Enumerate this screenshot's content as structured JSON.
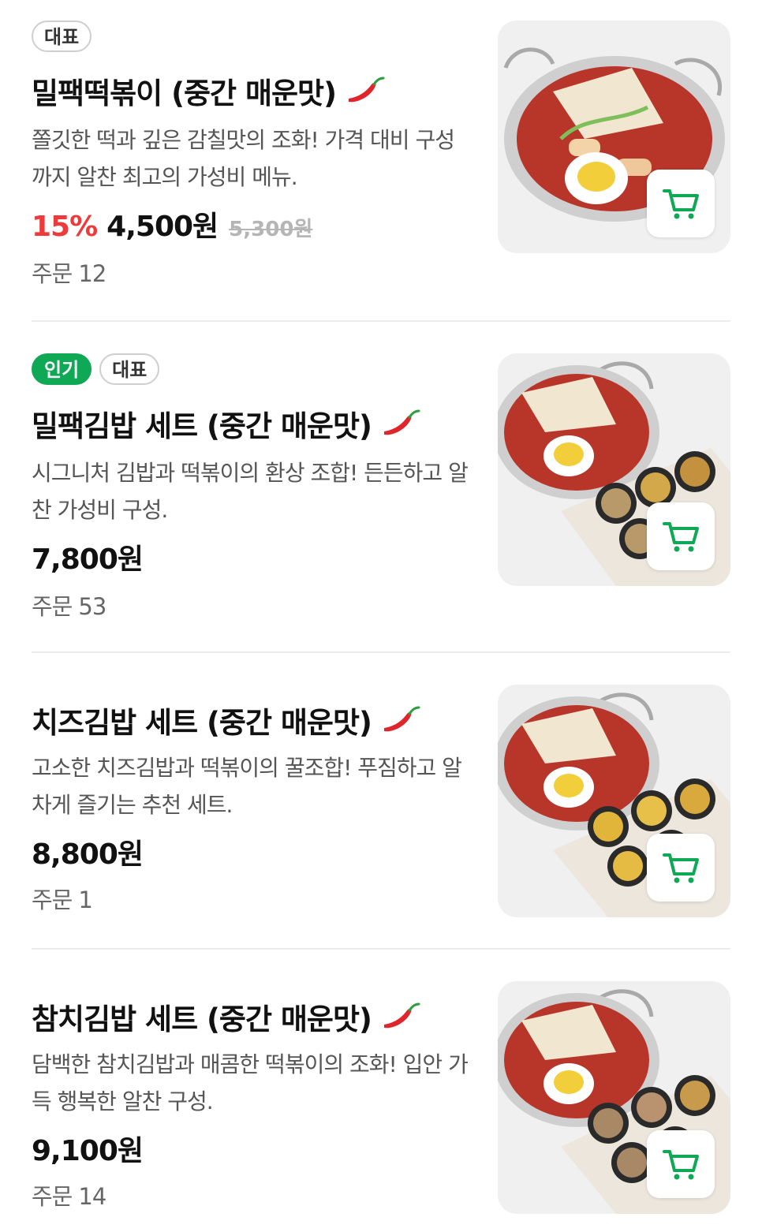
{
  "items": [
    {
      "badges": {
        "rep": "대표"
      },
      "name": "밀팩떡볶이 (중간 매운맛)",
      "desc": "쫄깃한 떡과 깊은 감칠맛의 조화! 가격 대비 구성까지 알찬 최고의 가성비 메뉴.",
      "discount": "15%",
      "price": "4,500원",
      "orig_price": "5,300원",
      "orders_label": "주문",
      "orders": "12",
      "image_icon": "tteokbokki-photo",
      "cart_icon": "cart-icon"
    },
    {
      "badges": {
        "pop": "인기",
        "rep": "대표"
      },
      "name": "밀팩김밥 세트 (중간 매운맛)",
      "desc": "시그니처 김밥과 떡볶이의 환상 조합! 든든하고 알찬 가성비 구성.",
      "price": "7,800원",
      "orders_label": "주문",
      "orders": "53",
      "image_icon": "gimbap-set-photo",
      "cart_icon": "cart-icon"
    },
    {
      "name": "치즈김밥 세트 (중간 매운맛)",
      "desc": "고소한 치즈김밥과 떡볶이의 꿀조합! 푸짐하고 알차게 즐기는 추천 세트.",
      "price": "8,800원",
      "orders_label": "주문",
      "orders": "1",
      "image_icon": "cheese-gimbap-set-photo",
      "cart_icon": "cart-icon"
    },
    {
      "name": "참치김밥 세트 (중간 매운맛)",
      "desc": "담백한 참치김밥과 매콤한 떡볶이의 조화! 입안 가득 행복한 알찬 구성.",
      "price": "9,100원",
      "orders_label": "주문",
      "orders": "14",
      "image_icon": "tuna-gimbap-set-photo",
      "cart_icon": "cart-icon"
    }
  ],
  "colors": {
    "accent_green": "#0fa855",
    "discount_red": "#ee3a3a",
    "pepper_red": "#e0262c"
  }
}
